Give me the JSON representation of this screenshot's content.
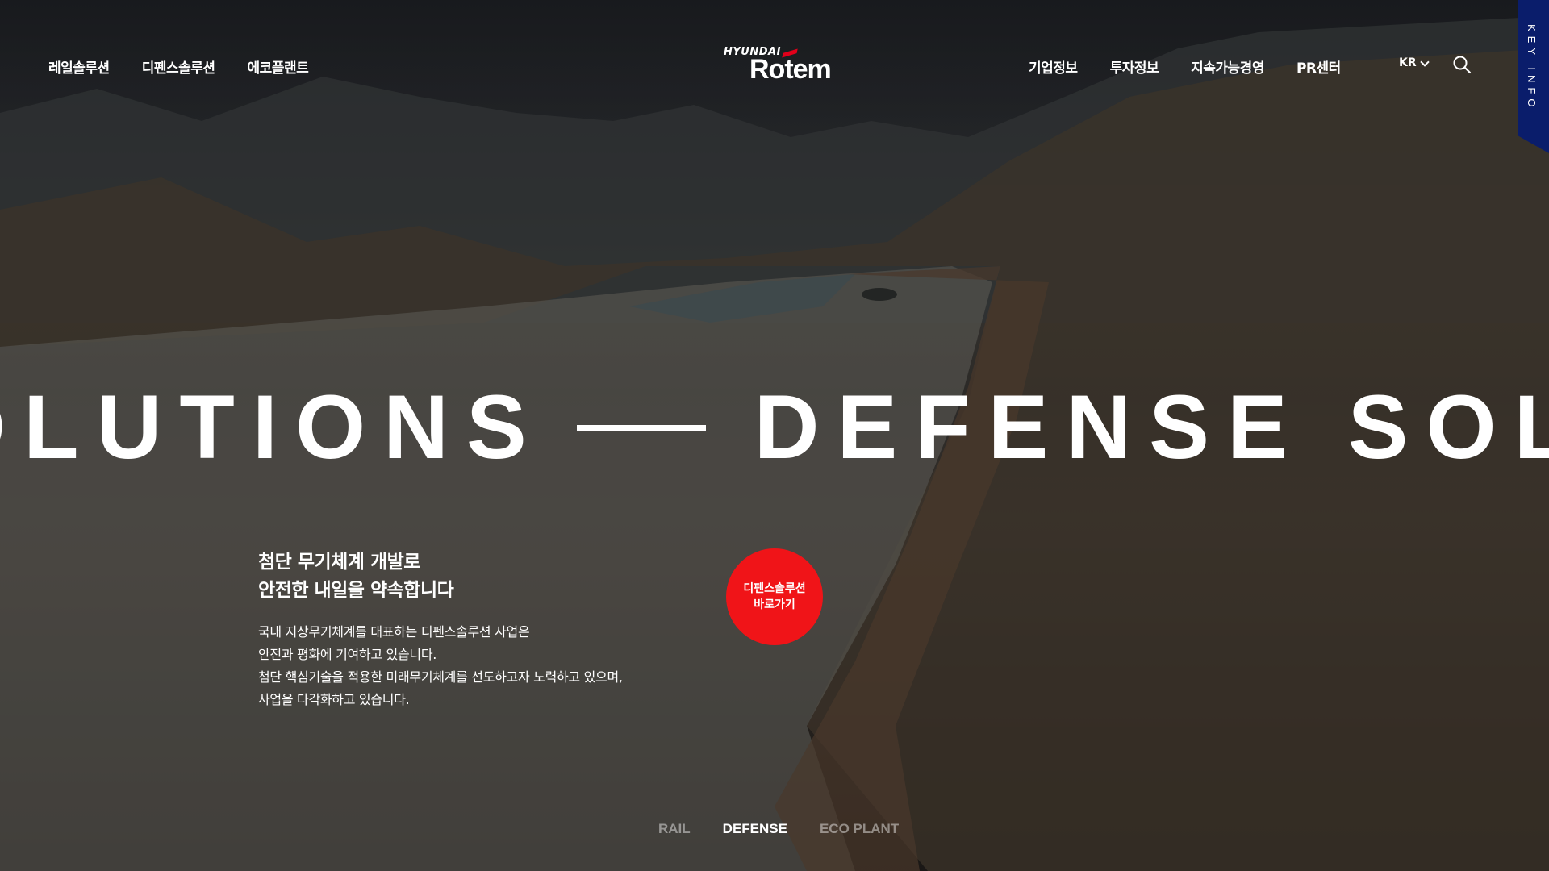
{
  "nav": {
    "left": [
      {
        "label": "레일솔루션"
      },
      {
        "label": "디펜스솔루션"
      },
      {
        "label": "에코플랜트"
      }
    ],
    "right": [
      {
        "label": "기업정보"
      },
      {
        "label": "투자정보"
      },
      {
        "label": "지속가능경영"
      },
      {
        "label": "PR센터"
      }
    ]
  },
  "logo": {
    "top": "HYUNDAI",
    "main": "Rotem"
  },
  "lang": {
    "label": "KR"
  },
  "key_info": {
    "label": "KEY INFO"
  },
  "marquee": {
    "text_left": "OLUTIONS",
    "text_right": "DEFENSE SOL"
  },
  "hero": {
    "tagline_line1": "첨단 무기체계 개발로",
    "tagline_line2": "안전한 내일을 약속합니다",
    "desc": [
      "국내 지상무기체계를 대표하는 디펜스솔루션 사업은",
      "안전과 평화에 기여하고 있습니다.",
      "첨단 핵심기술을 적용한 미래무기체계를 선도하고자 노력하고 있으며,",
      "사업을 다각화하고 있습니다."
    ],
    "cta_line1": "디펜스솔루션",
    "cta_line2": "바로가기"
  },
  "tabs": [
    {
      "label": "RAIL",
      "active": false
    },
    {
      "label": "DEFENSE",
      "active": true
    },
    {
      "label": "ECO PLANT",
      "active": false
    }
  ],
  "colors": {
    "accent": "#f01418",
    "key_info_bg": "#0a1d6b",
    "logo_accent": "#e2001a"
  }
}
